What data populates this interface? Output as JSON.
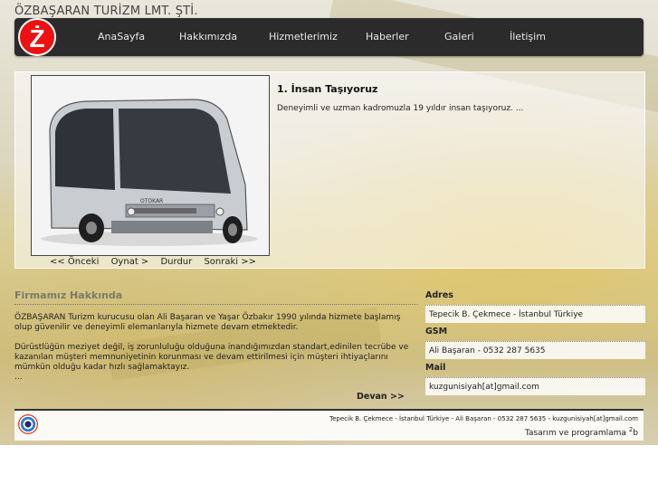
{
  "site": {
    "title": "ÖZBAŞARAN TURİZM LMT. ŞTİ.",
    "logo_letter": "Ż"
  },
  "nav": {
    "items": [
      {
        "label": "AnaSayfa"
      },
      {
        "label": "Hakkımızda"
      },
      {
        "label": "Hizmetlerimiz"
      },
      {
        "label": "Haberler"
      },
      {
        "label": "Galeri"
      },
      {
        "label": "İletişim"
      }
    ]
  },
  "slider": {
    "title": "1. İnsan Taşıyoruz",
    "text": "Deneyimli ve uzman kadromuzla 19 yıldır insan taşıyoruz. ...",
    "image_label": "OTOKAR",
    "controls": {
      "prev": "<< Önceki",
      "play": "Oynat >",
      "stop": "Durdur",
      "next": "Sonraki >>"
    }
  },
  "about": {
    "title": "Firmamız Hakkında",
    "paragraph1": "ÖZBAŞARAN Turizm kurucusu olan Ali Başaran ve Yaşar Özbakır 1990 yılında hizmete başlamış olup güvenilir ve deneyimli elemanlarıyla hizmete devam etmektedir.",
    "paragraph2": "Dürüstlüğün meziyet değil, iş zorunluluğu olduğuna inandığımızdan standart,edinilen tecrübe ve kazanılan müşteri memnuniyetinin korunması ve devam ettirilmesi için müşteri ihtiyaçlarını mümkün olduğu kadar hızlı sağlamaktayız.",
    "ellipsis": "...",
    "more": "Devan >>"
  },
  "contact": {
    "address_label": "Adres",
    "address": "Tepecik B. Çekmece - İstanbul Türkiye",
    "gsm_label": "GSM",
    "gsm": "Ali Başaran - 0532 287 5635",
    "mail_label": "Mail",
    "mail": "kuzgunisiyah[at]gmail.com"
  },
  "footer": {
    "info": "Tepecik B. Çekmece - İstanbul Türkiye - Ali Başaran - 0532 287 5635 - kuzgunisiyah[at]gmail.com",
    "credit": "Tasarım ve programlama ",
    "credit_sup": "2",
    "credit_suffix": "b"
  },
  "colors": {
    "navbar": "#2b2b2b",
    "logo_red": "#e11111",
    "about_title": "#7a7a6a"
  }
}
